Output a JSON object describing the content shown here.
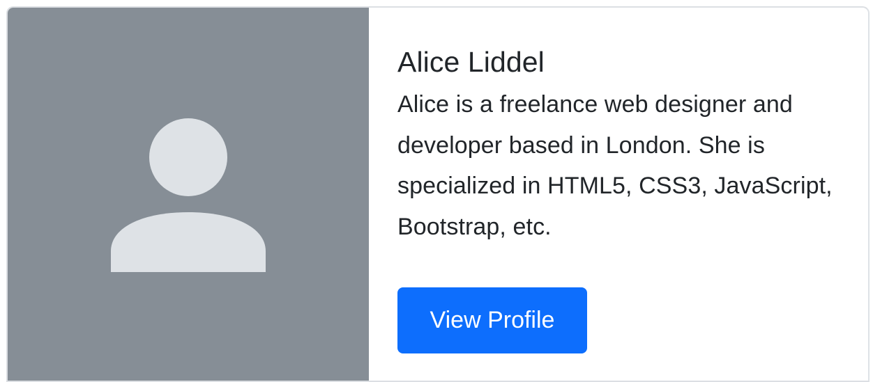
{
  "card": {
    "image": {
      "icon": "person-placeholder-icon",
      "background_color": "#868e96",
      "icon_color": "#dee2e6"
    },
    "title": "Alice Liddel",
    "text": "Alice is a freelance web designer and developer based in London. She is specialized in HTML5, CSS3, JavaScript, Bootstrap, etc.",
    "button_label": "View Profile",
    "button_color": "#0d6efd"
  }
}
